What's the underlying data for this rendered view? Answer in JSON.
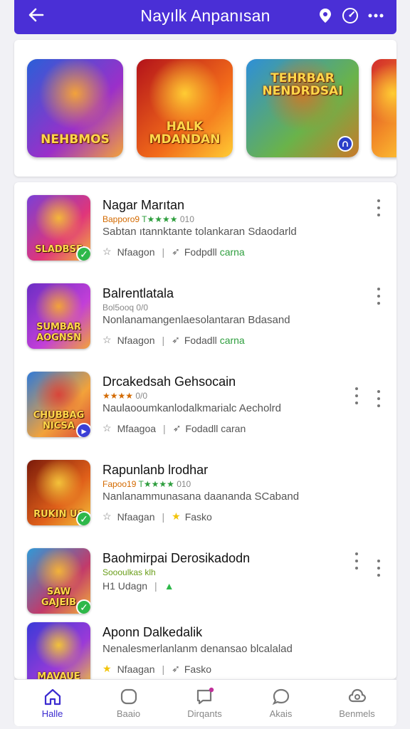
{
  "header": {
    "title": "Nayılk Anpanısan",
    "back_icon": "arrow-left-icon",
    "actions": [
      "location-icon",
      "clock-icon",
      "more-vert-icon"
    ]
  },
  "carousel": {
    "items": [
      {
        "label": "NEHBMOS",
        "colors": [
          "#2a5fd8",
          "#9b2fc9",
          "#f2a23a"
        ]
      },
      {
        "label": "HALK MDANDAN",
        "colors": [
          "#b3121a",
          "#f26b1a",
          "#ffcc33"
        ]
      },
      {
        "label": "TEHRBAR NENDRDSAI",
        "colors": [
          "#2e8fd8",
          "#6ab34a",
          "#c97a2a"
        ]
      },
      {
        "label": "",
        "colors": [
          "#d22b2b",
          "#f28c28",
          "#ffcc33"
        ]
      }
    ]
  },
  "apps": [
    {
      "name": "Nagar Marıtan",
      "meta_orange": "Bapporo9 ",
      "meta_green": "T★★★★",
      "meta_grey": " 010",
      "description": "Sabtan ıtannktante tolankaran Sdaodarld",
      "left_text": "Nfaagon",
      "right_text": "Fodpdll",
      "right_extra": "carna",
      "icon_label": "SLADBSE",
      "icon_colors": [
        "#7a3fd6",
        "#e0367a",
        "#f4b63a"
      ],
      "badge": "check",
      "left_icon": "star-outline-icon",
      "right_icon": "thumb-icon"
    },
    {
      "name": "Balrentlatala",
      "meta_orange": "",
      "meta_green": "",
      "meta_grey": "Bol5ooq 0/0",
      "description": "Nonlanamangenlaesolantaran Bdasand",
      "left_text": "Nfaagon",
      "right_text": "Fodadll",
      "right_extra": "carna",
      "icon_label": "SUMBAR AOGNSN",
      "icon_colors": [
        "#6a2ec4",
        "#c23fd8",
        "#f2a23a"
      ],
      "badge": "",
      "left_icon": "star-outline-icon",
      "right_icon": "thumb-icon"
    },
    {
      "name": "Drcakedsah Gehsocain",
      "meta_orange": "★★★★",
      "meta_green": "",
      "meta_grey": "0/0",
      "description": "Naulaooumkanlodalkmarialc Aecholrd",
      "left_text": "Mfaagoa",
      "right_text": "Fodadll caran",
      "right_extra": "",
      "icon_label": "CHUBBAG NICSA",
      "icon_colors": [
        "#2f7ad8",
        "#f2a23a",
        "#d8453a"
      ],
      "badge": "play",
      "left_icon": "star-outline-icon",
      "right_icon": "thumb-icon"
    },
    {
      "name": "Rapunlanb lrodhar",
      "meta_orange": "Fapoo19 ",
      "meta_green": "T★★★★",
      "meta_grey": " 010",
      "description": "Nanlanammunasana daananda SCaband",
      "left_text": "Nfaagan",
      "right_text": "Fasko",
      "right_extra": "",
      "icon_label": "RUKIN US",
      "icon_colors": [
        "#7a1a0a",
        "#e0601a",
        "#f4c23a"
      ],
      "badge": "check",
      "left_icon": "star-outline-icon",
      "right_icon": "star-yellow-icon"
    },
    {
      "name": "Baohmirpai Derosikadodn",
      "meta_orange": "",
      "meta_green": "Soooulkas klh",
      "meta_grey": "",
      "description": "",
      "left_text": "H1 Udagn",
      "right_text": "",
      "right_extra": "",
      "icon_label": "SAW GAJEIB",
      "icon_colors": [
        "#2f9ad8",
        "#c23a6a",
        "#f2b23a"
      ],
      "badge": "check",
      "left_icon": "",
      "right_icon": "thumb-green-icon"
    },
    {
      "name": "Aponn Dalkedalik",
      "meta_orange": "",
      "meta_green": "",
      "meta_grey": "",
      "description": "Nenalesmerlanlanm denansao blcalalad",
      "left_text": "Nfaagan",
      "right_text": "Fasko",
      "right_extra": "",
      "icon_label": "MAVAUE",
      "icon_colors": [
        "#3a3ad8",
        "#9a3ad8",
        "#f2c23a"
      ],
      "badge": "",
      "left_icon": "star-yellow-icon",
      "right_icon": "thumb-icon"
    }
  ],
  "nav": {
    "items": [
      {
        "label": "Halle",
        "icon": "home-icon",
        "active": true
      },
      {
        "label": "Baaio",
        "icon": "square-icon",
        "active": false
      },
      {
        "label": "Dirqants",
        "icon": "chat-dot-icon",
        "active": false
      },
      {
        "label": "Akais",
        "icon": "bubble-icon",
        "active": false
      },
      {
        "label": "Benmels",
        "icon": "gear-cloud-icon",
        "active": false
      }
    ]
  },
  "colors": {
    "accent": "#4a2fd6",
    "active_nav": "#3b2bd0",
    "green": "#2e9e3e",
    "orange": "#d36a00"
  }
}
